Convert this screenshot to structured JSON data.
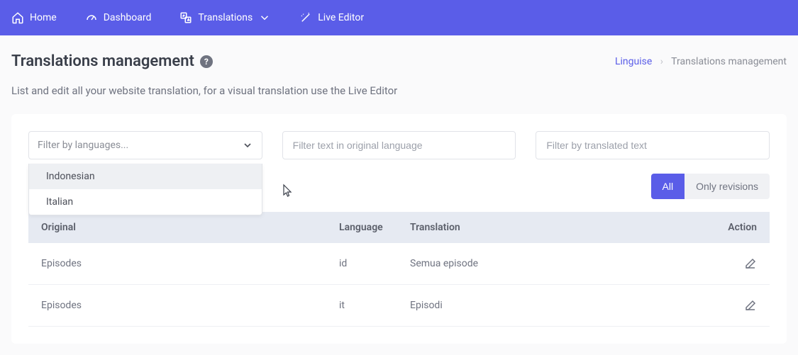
{
  "nav": {
    "home": "Home",
    "dashboard": "Dashboard",
    "translations": "Translations",
    "live_editor": "Live Editor"
  },
  "header": {
    "title": "Translations management",
    "help": "?",
    "bc_link": "Linguise",
    "bc_current": "Translations management"
  },
  "subtitle": "List and edit all your website translation, for a visual translation use the Live Editor",
  "filters": {
    "lang_placeholder": "Filter by languages...",
    "original_placeholder": "Filter text in original language",
    "translated_placeholder": "Filter by translated text",
    "dropdown": {
      "opt0": "Indonesian",
      "opt1": "Italian"
    }
  },
  "toggle": {
    "all": "All",
    "revisions": "Only revisions"
  },
  "table": {
    "head_original": "Original",
    "head_lang": "Language",
    "head_trans": "Translation",
    "head_action": "Action",
    "rows": [
      {
        "original": "Episodes",
        "lang": "id",
        "translation": "Semua episode"
      },
      {
        "original": "Episodes",
        "lang": "it",
        "translation": "Episodi"
      }
    ]
  }
}
